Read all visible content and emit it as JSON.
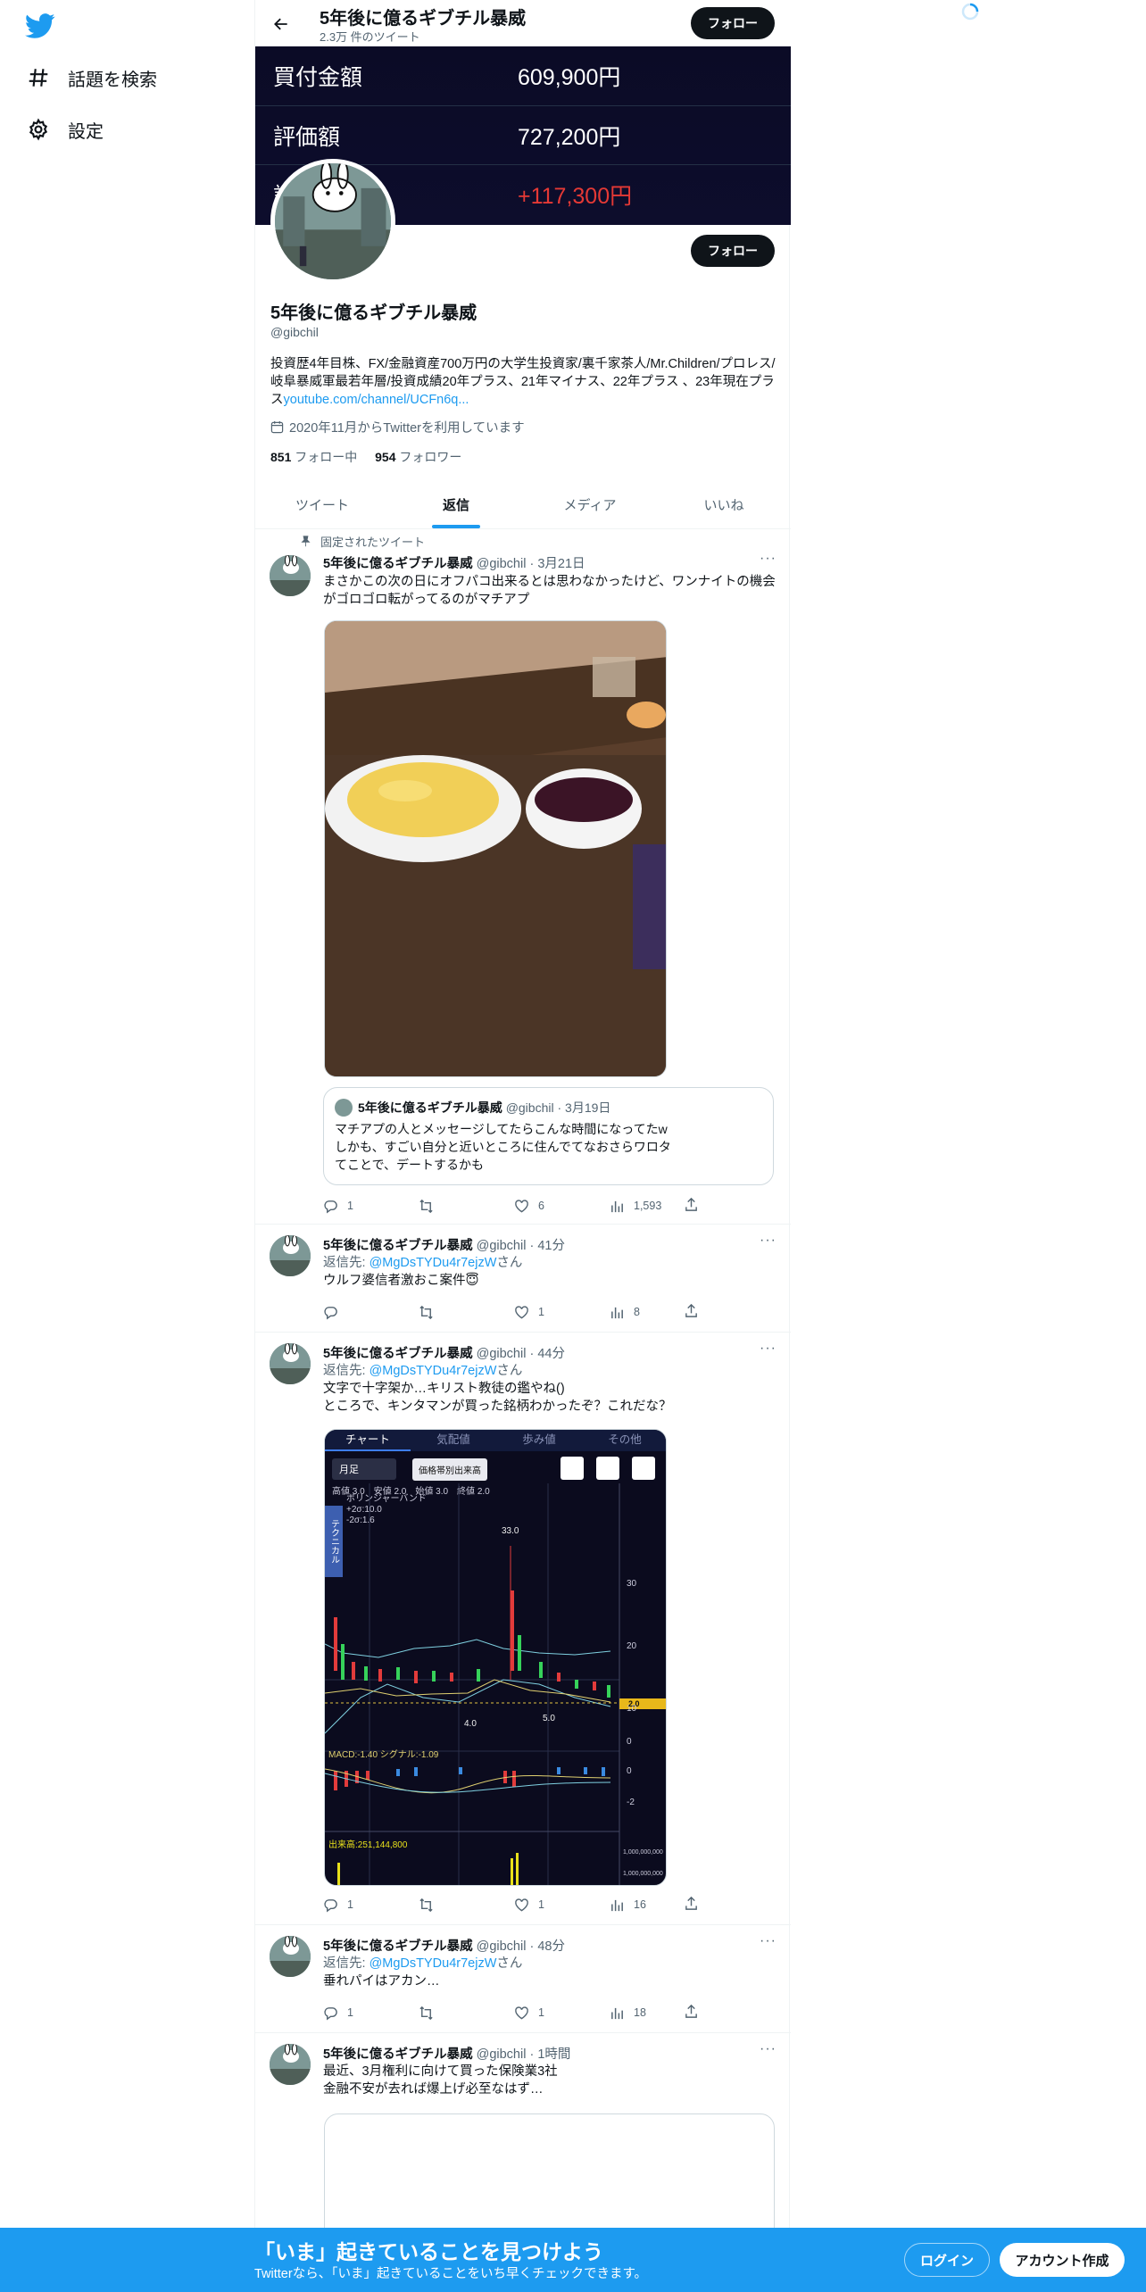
{
  "nav": {
    "items": [
      {
        "label": "話題を検索",
        "icon": "hash-icon"
      },
      {
        "label": "設定",
        "icon": "gear-icon"
      }
    ]
  },
  "header": {
    "name": "5年後に億るギブチル暴威",
    "tweet_count": "2.3万 件のツイート",
    "follow_label": "フォロー"
  },
  "banner": {
    "rows": [
      {
        "key": "買付金額",
        "value": "609,900円"
      },
      {
        "key": "評価額",
        "value": "727,200円"
      },
      {
        "key": "評",
        "value": "+117,300円"
      }
    ],
    "gain_color": "#e53935"
  },
  "profile": {
    "name": "5年後に億るギブチル暴威",
    "handle": "@gibchil",
    "bio": "投資歴4年目株、FX/金融資産700万円の大学生投資家/裏千家茶人/Mr.Children/プロレス/岐阜暴威軍最若年層/投資成績20年プラス、21年マイナス、22年プラス 、23年現在プラス",
    "bio_link": "youtube.com/channel/UCFn6q...",
    "joined": "2020年11月からTwitterを利用しています",
    "following_count": "851",
    "following_label": "フォロー中",
    "followers_count": "954",
    "followers_label": "フォロワー",
    "follow_label": "フォロー"
  },
  "tabs": [
    {
      "label": "ツイート",
      "active": false
    },
    {
      "label": "返信",
      "active": true
    },
    {
      "label": "メディア",
      "active": false
    },
    {
      "label": "いいね",
      "active": false
    }
  ],
  "tweets": [
    {
      "pinned_label": "固定されたツイート",
      "name": "5年後に億るギブチル暴威",
      "handle": "@gibchil",
      "time": "3月21日",
      "text": "まさかこの次の日にオフパコ出来るとは思わなかったけど、ワンナイトの機会がゴロゴロ転がってるのがマチアプ",
      "quote": {
        "name": "5年後に億るギブチル暴威",
        "handle": "@gibchil",
        "time": "3月19日",
        "text": "マチアプの人とメッセージしてたらこんな時間になってたw\nしかも、すごい自分と近いところに住んでてなおさらワロタ\nてことで、デートするかも"
      },
      "replies": "1",
      "retweets": "",
      "likes": "6",
      "views": "1,593"
    },
    {
      "name": "5年後に億るギブチル暴威",
      "handle": "@gibchil",
      "time": "41分",
      "reply_prefix": "返信先: ",
      "reply_to": "@MgDsTYDu4r7ejzW",
      "reply_suffix": "さん",
      "text": "ウルフ婆信者激おこ案件😇",
      "replies": "",
      "retweets": "",
      "likes": "1",
      "views": "8"
    },
    {
      "name": "5年後に億るギブチル暴威",
      "handle": "@gibchil",
      "time": "44分",
      "reply_prefix": "返信先: ",
      "reply_to": "@MgDsTYDu4r7ejzW",
      "reply_suffix": "さん",
      "text": "文字で十字架か…キリスト教徒の鑑やね()\nところで、キンタマンが買った銘柄わかったぞ？これだな？",
      "replies": "1",
      "retweets": "",
      "likes": "1",
      "views": "16"
    },
    {
      "name": "5年後に億るギブチル暴威",
      "handle": "@gibchil",
      "time": "48分",
      "reply_prefix": "返信先: ",
      "reply_to": "@MgDsTYDu4r7ejzW",
      "reply_suffix": "さん",
      "text": "垂れパイはアカン…",
      "replies": "1",
      "retweets": "",
      "likes": "1",
      "views": "18"
    },
    {
      "name": "5年後に億るギブチル暴威",
      "handle": "@gibchil",
      "time": "1時間",
      "text": "最近、3月権利に向けて買った保険業3社\n金融不安が去れば爆上げ必至なはず…"
    }
  ],
  "stock_chart": {
    "tabs": [
      "チャート",
      "気配値",
      "歩み値",
      "その他"
    ],
    "period": "月足",
    "mode_button": "価格帯別出来高",
    "ohlc": {
      "高値": "3.0",
      "安値": "2.0",
      "始値": "3.0",
      "終値": "2.0"
    },
    "legend_title": "ボリンジャーバンド",
    "legend_plus": "+2σ:10.0",
    "legend_minus": "-2σ:1.6",
    "side_tab": "テクニカル",
    "price_axis": [
      "30",
      "20",
      "10",
      "0"
    ],
    "peak_label": "33.0",
    "low_label_1": "4.0",
    "low_label_2": "5.0",
    "current_price": "2.0",
    "macd_label": "MACD:-1.40  シグナル:-1.09",
    "macd_axis": [
      "0",
      "-2"
    ],
    "volume_label": "出来高:251,144,800",
    "volume_axis": [
      "1,000,000,000",
      "1,000,000,000"
    ]
  },
  "bottom_bar": {
    "title": "「いま」起きていることを見つけよう",
    "subtitle": "Twitterなら、「いま」起きていることをいち早くチェックできます。",
    "login_label": "ログイン",
    "signup_label": "アカウント作成"
  },
  "colors": {
    "accent": "#1d9bf0",
    "text": "#0f1419",
    "muted": "#536471"
  }
}
